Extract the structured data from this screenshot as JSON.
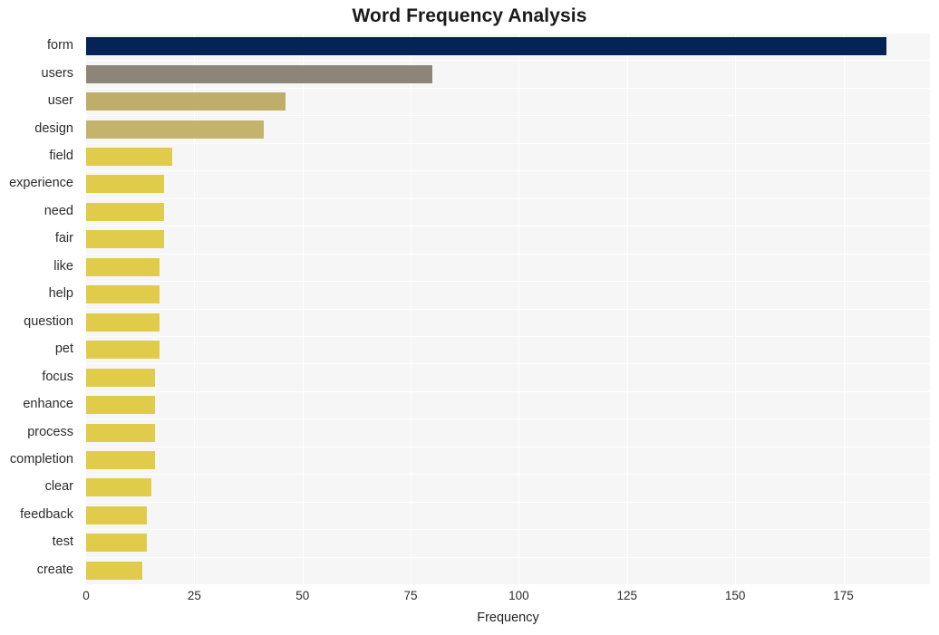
{
  "chart_data": {
    "type": "bar",
    "orientation": "horizontal",
    "title": "Word Frequency Analysis",
    "xlabel": "Frequency",
    "ylabel": "",
    "categories": [
      "form",
      "users",
      "user",
      "design",
      "field",
      "experience",
      "need",
      "fair",
      "like",
      "help",
      "question",
      "pet",
      "focus",
      "enhance",
      "process",
      "completion",
      "clear",
      "feedback",
      "test",
      "create"
    ],
    "values": [
      185,
      80,
      46,
      41,
      20,
      18,
      18,
      18,
      17,
      17,
      17,
      17,
      16,
      16,
      16,
      16,
      15,
      14,
      14,
      13
    ],
    "bar_colors": [
      "#032455",
      "#8d8678",
      "#bfae6a",
      "#c3b36d",
      "#e0cc4a",
      "#e0cc4a",
      "#e0cc4a",
      "#e0cc4a",
      "#e0cc4a",
      "#e0cc4a",
      "#e0cc4a",
      "#e0cc4a",
      "#e0cc4a",
      "#e0cc4a",
      "#e0cc4a",
      "#e0cc4a",
      "#e0cc4a",
      "#e0cc4a",
      "#e0cc4a",
      "#e0cc4a"
    ],
    "xlim": [
      0,
      195
    ],
    "xticks": [
      0,
      25,
      50,
      75,
      100,
      125,
      150,
      175
    ],
    "xtick_labels": [
      "0",
      "25",
      "50",
      "75",
      "100",
      "125",
      "150",
      "175"
    ],
    "grid": true,
    "grid_color": "#ffffff",
    "plot_background": "#f6f6f6",
    "figure_background": "#ffffff",
    "legend": null
  }
}
